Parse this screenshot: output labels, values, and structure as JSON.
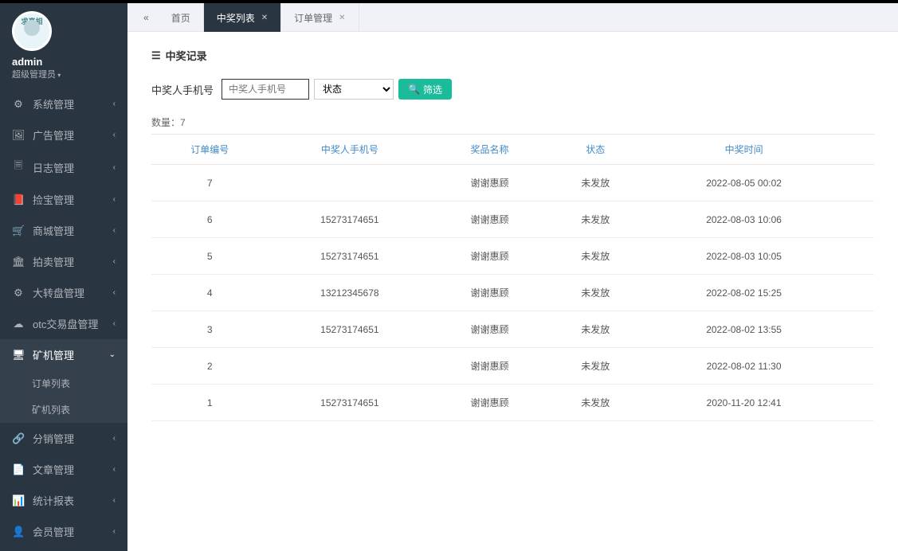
{
  "user": {
    "avatar_text": "求真相",
    "name": "admin",
    "role": "超级管理员"
  },
  "nav": [
    {
      "icon": "⚙",
      "label": "系统管理",
      "expanded": false
    },
    {
      "icon": "🖼",
      "label": "广告管理",
      "expanded": false
    },
    {
      "icon": "🗏",
      "label": "日志管理",
      "expanded": false
    },
    {
      "icon": "📕",
      "label": "捡宝管理",
      "expanded": false
    },
    {
      "icon": "🛒",
      "label": "商城管理",
      "expanded": false
    },
    {
      "icon": "🏛",
      "label": "拍卖管理",
      "expanded": false
    },
    {
      "icon": "⚙",
      "label": "大转盘管理",
      "expanded": false
    },
    {
      "icon": "☁",
      "label": "otc交易盘管理",
      "expanded": false
    },
    {
      "icon": "🖥",
      "label": "矿机管理",
      "expanded": true,
      "active": true,
      "sub": [
        {
          "label": "订单列表"
        },
        {
          "label": "矿机列表"
        }
      ]
    },
    {
      "icon": "🔗",
      "label": "分销管理",
      "expanded": false
    },
    {
      "icon": "📄",
      "label": "文章管理",
      "expanded": false
    },
    {
      "icon": "📊",
      "label": "统计报表",
      "expanded": false
    },
    {
      "icon": "👤",
      "label": "会员管理",
      "expanded": false
    }
  ],
  "tabs": {
    "back_icon": "«",
    "items": [
      {
        "label": "首页",
        "closable": false,
        "active": false
      },
      {
        "label": "中奖列表",
        "closable": true,
        "active": true
      },
      {
        "label": "订单管理",
        "closable": true,
        "active": false
      }
    ]
  },
  "panel": {
    "title": "中奖记录",
    "filter_label": "中奖人手机号",
    "filter_placeholder": "中奖人手机号",
    "status_select": "状态",
    "filter_btn": "筛选",
    "count_prefix": "数量：",
    "count_value": "7"
  },
  "table": {
    "headers": [
      "订单编号",
      "中奖人手机号",
      "奖品名称",
      "状态",
      "中奖时间",
      ""
    ],
    "rows": [
      {
        "id": "7",
        "phone": "",
        "prize": "谢谢惠顾",
        "status": "未发放",
        "time": "2022-08-05 00:02"
      },
      {
        "id": "6",
        "phone": "15273174651",
        "prize": "谢谢惠顾",
        "status": "未发放",
        "time": "2022-08-03 10:06"
      },
      {
        "id": "5",
        "phone": "15273174651",
        "prize": "谢谢惠顾",
        "status": "未发放",
        "time": "2022-08-03 10:05"
      },
      {
        "id": "4",
        "phone": "13212345678",
        "prize": "谢谢惠顾",
        "status": "未发放",
        "time": "2022-08-02 15:25"
      },
      {
        "id": "3",
        "phone": "15273174651",
        "prize": "谢谢惠顾",
        "status": "未发放",
        "time": "2022-08-02 13:55"
      },
      {
        "id": "2",
        "phone": "",
        "prize": "谢谢惠顾",
        "status": "未发放",
        "time": "2022-08-02 11:30"
      },
      {
        "id": "1",
        "phone": "15273174651",
        "prize": "谢谢惠顾",
        "status": "未发放",
        "time": "2020-11-20 12:41"
      }
    ]
  }
}
